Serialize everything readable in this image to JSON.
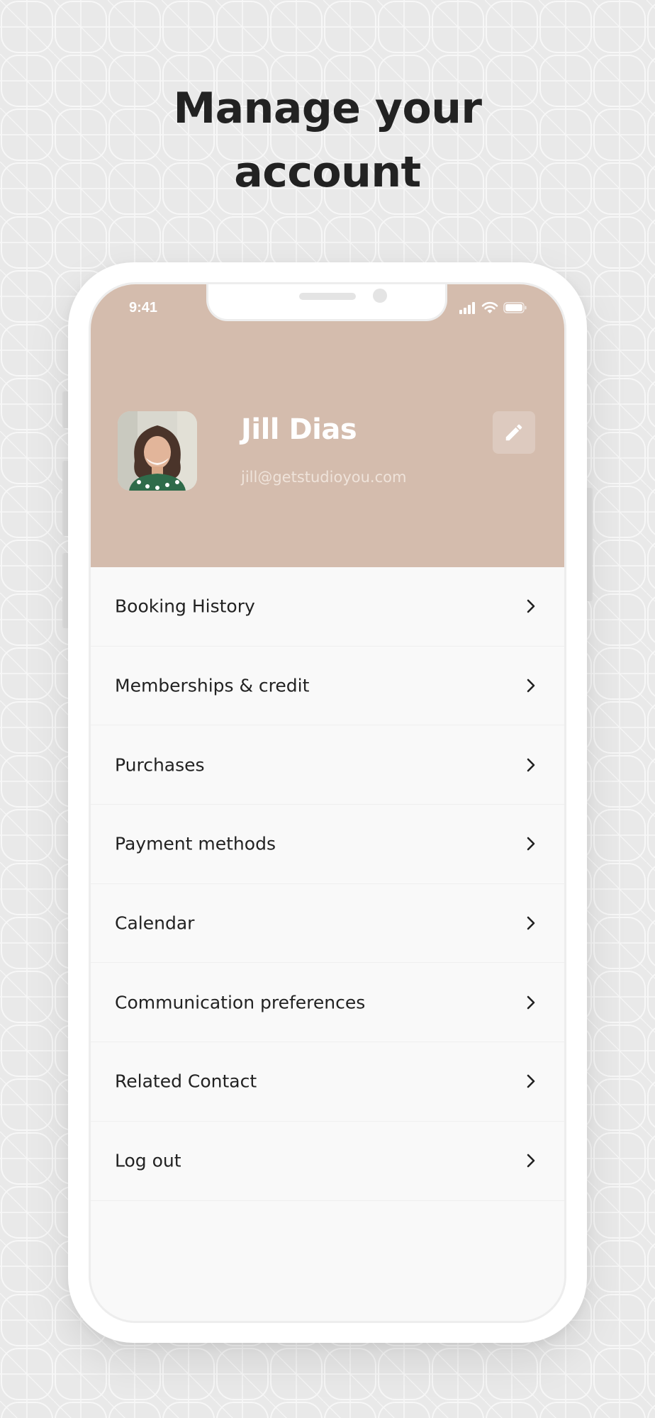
{
  "headline": {
    "line1": "Manage your",
    "line2": "account"
  },
  "status_bar": {
    "time": "9:41",
    "icons": [
      "cellular-signal-icon",
      "wifi-icon",
      "battery-icon"
    ]
  },
  "profile": {
    "name": "Jill Dias",
    "email": "jill@getstudioyou.com",
    "edit_icon": "pencil-icon"
  },
  "menu": {
    "items": [
      {
        "label": "Booking History",
        "icon": "chevron-right-icon"
      },
      {
        "label": "Memberships & credit",
        "icon": "chevron-right-icon"
      },
      {
        "label": "Purchases",
        "icon": "chevron-right-icon"
      },
      {
        "label": "Payment methods",
        "icon": "chevron-right-icon"
      },
      {
        "label": "Calendar",
        "icon": "chevron-right-icon"
      },
      {
        "label": "Communication preferences",
        "icon": "chevron-right-icon"
      },
      {
        "label": "Related Contact",
        "icon": "chevron-right-icon"
      },
      {
        "label": "Log out",
        "icon": "chevron-right-icon"
      }
    ]
  },
  "colors": {
    "background": "#e9e9e9",
    "header": "#d4bcad",
    "text": "#222222",
    "list_background": "#f9f9f9"
  }
}
